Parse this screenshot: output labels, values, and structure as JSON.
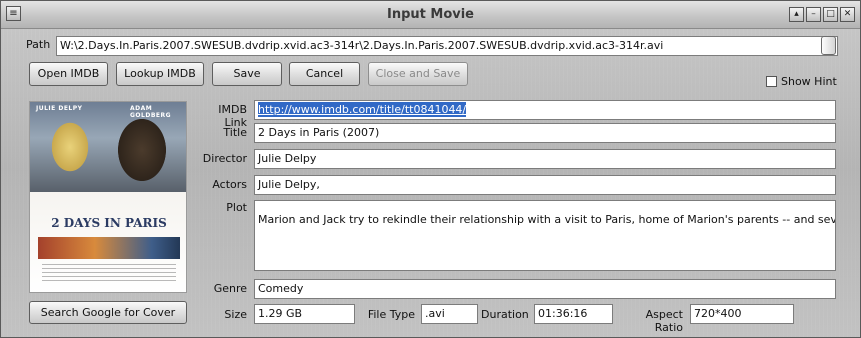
{
  "window": {
    "title": "Input Movie",
    "system_menu_glyph": "≡",
    "controls": {
      "restore": "▴",
      "minimize": "–",
      "maximize": "□",
      "close": "✕"
    }
  },
  "path": {
    "label": "Path",
    "value": "W:\\2.Days.In.Paris.2007.SWESUB.dvdrip.xvid.ac3-314r\\2.Days.In.Paris.2007.SWESUB.dvdrip.xvid.ac3-314r.avi"
  },
  "toolbar": {
    "open_imdb": "Open IMDB",
    "lookup_imdb": "Lookup IMDB",
    "save": "Save",
    "cancel": "Cancel",
    "close_and_save": "Close and Save",
    "show_hint": "Show Hint"
  },
  "poster": {
    "actor_left": "JULIE DELPY",
    "actor_right": "ADAM GOLDBERG",
    "title": "2 DAYS IN PARIS"
  },
  "fields": {
    "imdb_link": {
      "label": "IMDB Link",
      "value": "http://www.imdb.com/title/tt0841044/"
    },
    "title": {
      "label": "Title",
      "value": "2 Days in Paris (2007)"
    },
    "director": {
      "label": "Director",
      "value": "Julie Delpy"
    },
    "actors": {
      "label": "Actors",
      "value": "Julie Delpy,"
    },
    "plot": {
      "label": "Plot",
      "value": "Marion and Jack try to rekindle their relationship with a visit to Paris, home of Marion's parents -- and several of her ex-lovers."
    },
    "genre": {
      "label": "Genre",
      "value": "Comedy"
    },
    "size": {
      "label": "Size",
      "value": "1.29 GB"
    },
    "file_type": {
      "label": "File Type",
      "value": ".avi"
    },
    "duration": {
      "label": "Duration",
      "value": "01:36:16"
    },
    "aspect_ratio": {
      "label": "Aspect Ratio",
      "value": "720*400"
    }
  },
  "search_cover_button": "Search Google for  Cover",
  "colors": {
    "selection": "#3169c6",
    "window_bg": "#bdbdbd"
  }
}
